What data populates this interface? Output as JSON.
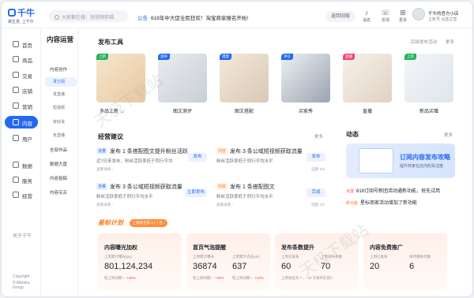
{
  "brand": {
    "name": "千牛",
    "slogan": "做生意, 上千牛"
  },
  "header": {
    "search_placeholder": "大家都在搜：短视频剪辑",
    "notice_tag": "公告",
    "notice_text": "618年中大促全民狂欢！淘宝商家报名开始!",
    "back_old": "返回旧版",
    "icons": [
      {
        "name": "bell-icon",
        "label": "消息"
      },
      {
        "name": "feedback-icon",
        "label": "反馈"
      },
      {
        "name": "grid-icon",
        "label": "更多"
      }
    ],
    "user_name": "千牛的官方小店",
    "user_sub": "主账号  设置主营"
  },
  "sidebar": {
    "items": [
      {
        "label": "首页",
        "icon": "home-icon"
      },
      {
        "label": "商品",
        "icon": "goods-icon"
      },
      {
        "label": "交易",
        "icon": "trade-icon"
      },
      {
        "label": "店铺",
        "icon": "shop-icon"
      },
      {
        "label": "营销",
        "icon": "marketing-icon"
      },
      {
        "label": "内容",
        "icon": "content-icon"
      },
      {
        "label": "用户",
        "icon": "user-icon"
      },
      {
        "label": "数据",
        "icon": "data-icon"
      },
      {
        "label": "服务",
        "icon": "service-icon"
      },
      {
        "label": "经营",
        "icon": "operation-icon"
      }
    ],
    "about": "关于千牛",
    "copyright": "Copyright",
    "company": "© Alibaba Group"
  },
  "subnav": {
    "title": "内容运营",
    "items": [
      {
        "label": "内容创作",
        "level": 1
      },
      {
        "label": "发订阅",
        "level": 2
      },
      {
        "label": "发直播",
        "level": 2
      },
      {
        "label": "短视频",
        "level": 2
      },
      {
        "label": "有好货",
        "level": 2
      },
      {
        "label": "负直播",
        "level": 2
      },
      {
        "label": "全部作品",
        "level": 1
      },
      {
        "label": "数据大盘",
        "level": 1
      },
      {
        "label": "内容投稿",
        "level": 1
      },
      {
        "label": "内容买买",
        "level": 1
      }
    ]
  },
  "tools": {
    "title": "发布工具",
    "more_left": "后续发布活动",
    "more": "更多",
    "items": [
      {
        "label": "多品上新 →",
        "badge": "上新",
        "badge_color": "#21b35b"
      },
      {
        "label": "图文测评",
        "badge": "测评",
        "badge_color": "#2468f2"
      },
      {
        "label": "图文搭配",
        "badge": "搭配",
        "badge_color": "#2468f2"
      },
      {
        "label": "买家秀",
        "badge": "评价",
        "badge_color": "#2468f2"
      },
      {
        "label": "直播",
        "badge": "直播",
        "badge_color": "#f0476e"
      },
      {
        "label": "新品买赠",
        "badge": "上新",
        "badge_color": "#21b35b"
      }
    ]
  },
  "suggestions": {
    "title": "经营建议",
    "more": "更多",
    "items": [
      {
        "tag": "流量",
        "title": "发布 1 条搭配图文提升粉丝活跃",
        "desc": "近7日来发布、粉丝活跃率低于同行平均",
        "meta": "查看详情 ›",
        "page": "",
        "button": "发布"
      },
      {
        "tag": "内容",
        "title": "发布 3 条公域短视频获取流量",
        "desc": "粉丝活跃率低于同行平均水平",
        "meta": "",
        "page": "选题 1/3",
        "button": "发布"
      },
      {
        "tag": "流量",
        "title": "发布 3 条公域短视频获取流量",
        "desc": "粉丝活跃率低于同行平均水平",
        "meta": "查看详情 ›",
        "page": "",
        "button": "立即发布"
      },
      {
        "tag": "内容",
        "title": "发布 1 条搭配图文",
        "desc": "粉丝活跃率低于同行平均水平",
        "meta": "查看详情 ›",
        "page": "选题 1/3",
        "button": "完成"
      }
    ]
  },
  "news": {
    "title": "动态",
    "more": "更多",
    "banner_title": "订阅内容发布攻略",
    "banner_sub": "提升商家在店内的关注度",
    "items": [
      {
        "tag": "大促",
        "text": "618订阅号新团活动通新功能，抢先试用",
        "color": "#f04438"
      },
      {
        "tag": "新功能",
        "text": "星标商家活动增加了新功能",
        "color": "#ff7a1a"
      }
    ]
  },
  "star": {
    "title": "星标计划",
    "pill": "上周排名第 4 / 7 名 ›"
  },
  "metrics": [
    {
      "title": "内容曝光加权",
      "labels": [
        "上周累计曝光(pv)"
      ],
      "values": [
        "801,124,234"
      ],
      "compares": [
        "较上周同期 -- ",
        "+45%"
      ]
    },
    {
      "title": "首页气泡提醒",
      "labels": [
        "上周累计曝光",
        "上周累计点击(uv)"
      ],
      "values": [
        "36874",
        "637"
      ],
      "compares": [
        "较上周同期 -- ",
        "+15%",
        "较上周同期 -- ",
        "+12%"
      ]
    },
    {
      "title": "发布条数提升",
      "labels": [
        "上周已发布",
        "上周发布条数"
      ],
      "values": [
        "60",
        "70"
      ],
      "compares": [
        "上周排名为 7 ， 10 次发布在前3"
      ]
    },
    {
      "title": "内容免费推广",
      "labels": [
        "上周已发布",
        "本月剩余次数"
      ],
      "values": [
        "20",
        "6"
      ],
      "compares": []
    }
  ],
  "watermark": "天极下载站"
}
